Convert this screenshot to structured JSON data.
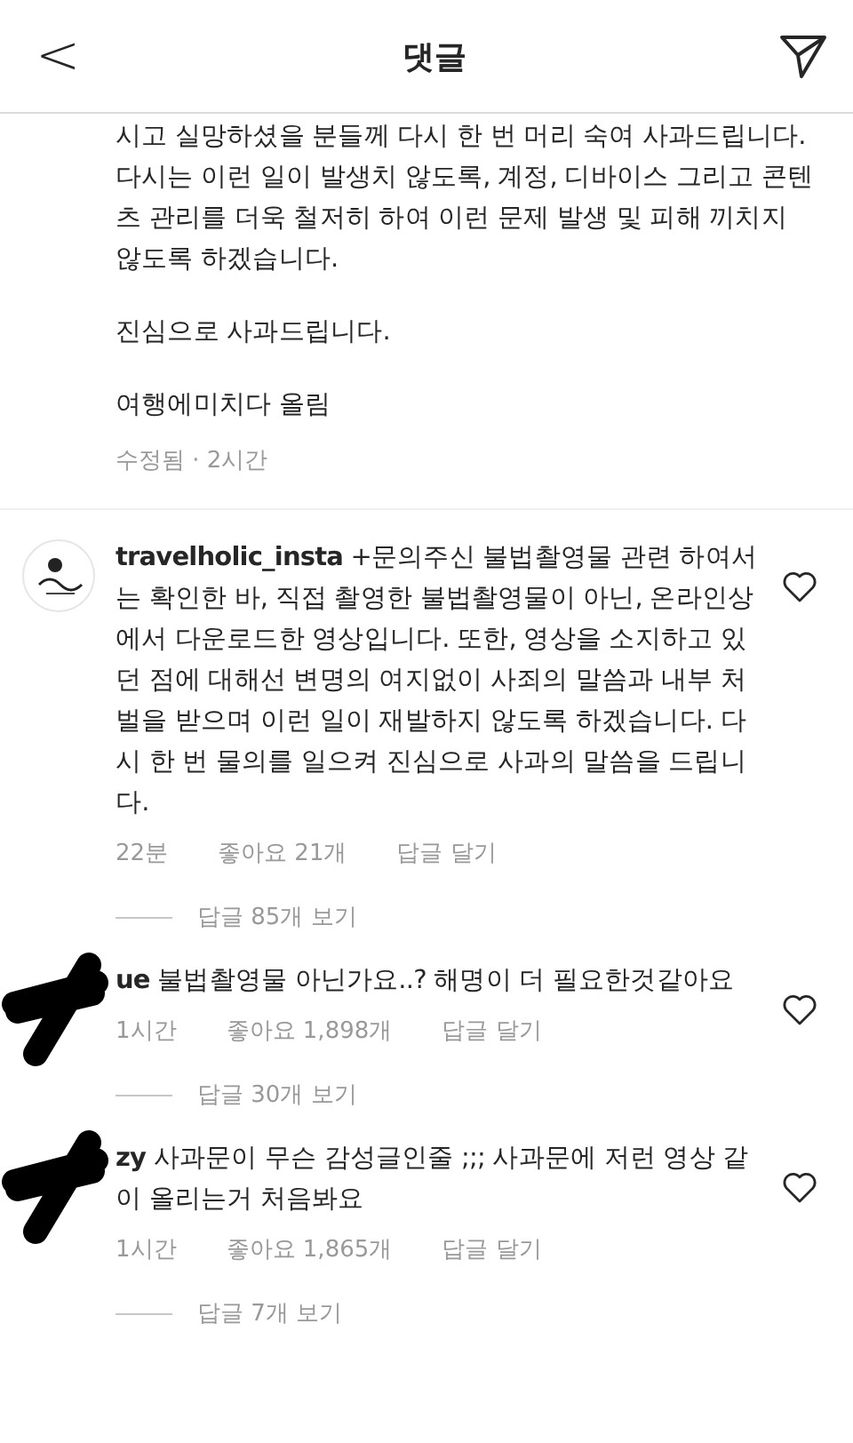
{
  "header": {
    "back": "<",
    "title": "댓글"
  },
  "caption": {
    "paragraphs": [
      "시고 실망하셨을 분들께 다시 한 번 머리 숙여 사과드립니다. 다시는 이런 일이 발생치 않도록, 계정, 디바이스 그리고 콘텐츠 관리를 더욱 철저히 하여 이런 문제 발생 및 피해 끼치지 않도록 하겠습니다.",
      "진심으로 사과드립니다.",
      "여행에미치다 올림"
    ],
    "meta": "수정됨 · 2시간"
  },
  "comments": [
    {
      "kind": "logo",
      "username": "travelholic_insta",
      "text": "+문의주신 불법촬영물 관련 하여서는 확인한 바, 직접 촬영한 불법촬영물이 아닌, 온라인상에서 다운로드한 영상입니다. 또한, 영상을 소지하고 있던 점에 대해선 변명의 여지없이 사죄의 말씀과 내부 처벌을 받으며 이런 일이 재발하지 않도록 하겠습니다. 다시 한 번 물의를 일으켜 진심으로 사과의 말씀을 드립니다.",
      "time": "22분",
      "likes": "좋아요 21개",
      "reply": "답글 달기",
      "view_replies": "답글 85개 보기"
    },
    {
      "kind": "redacted",
      "username": "ue",
      "text": "불법촬영물 아닌가요..? 해명이 더 필요한것같아요",
      "time": "1시간",
      "likes": "좋아요 1,898개",
      "reply": "답글 달기",
      "view_replies": "답글 30개 보기"
    },
    {
      "kind": "redacted",
      "username": "zy",
      "text": "사과문이 무슨 감성글인줄 ;;; 사과문에 저런 영상 같이 올리는거 처음봐요",
      "time": "1시간",
      "likes": "좋아요 1,865개",
      "reply": "답글 달기",
      "view_replies": "답글 7개 보기"
    }
  ]
}
